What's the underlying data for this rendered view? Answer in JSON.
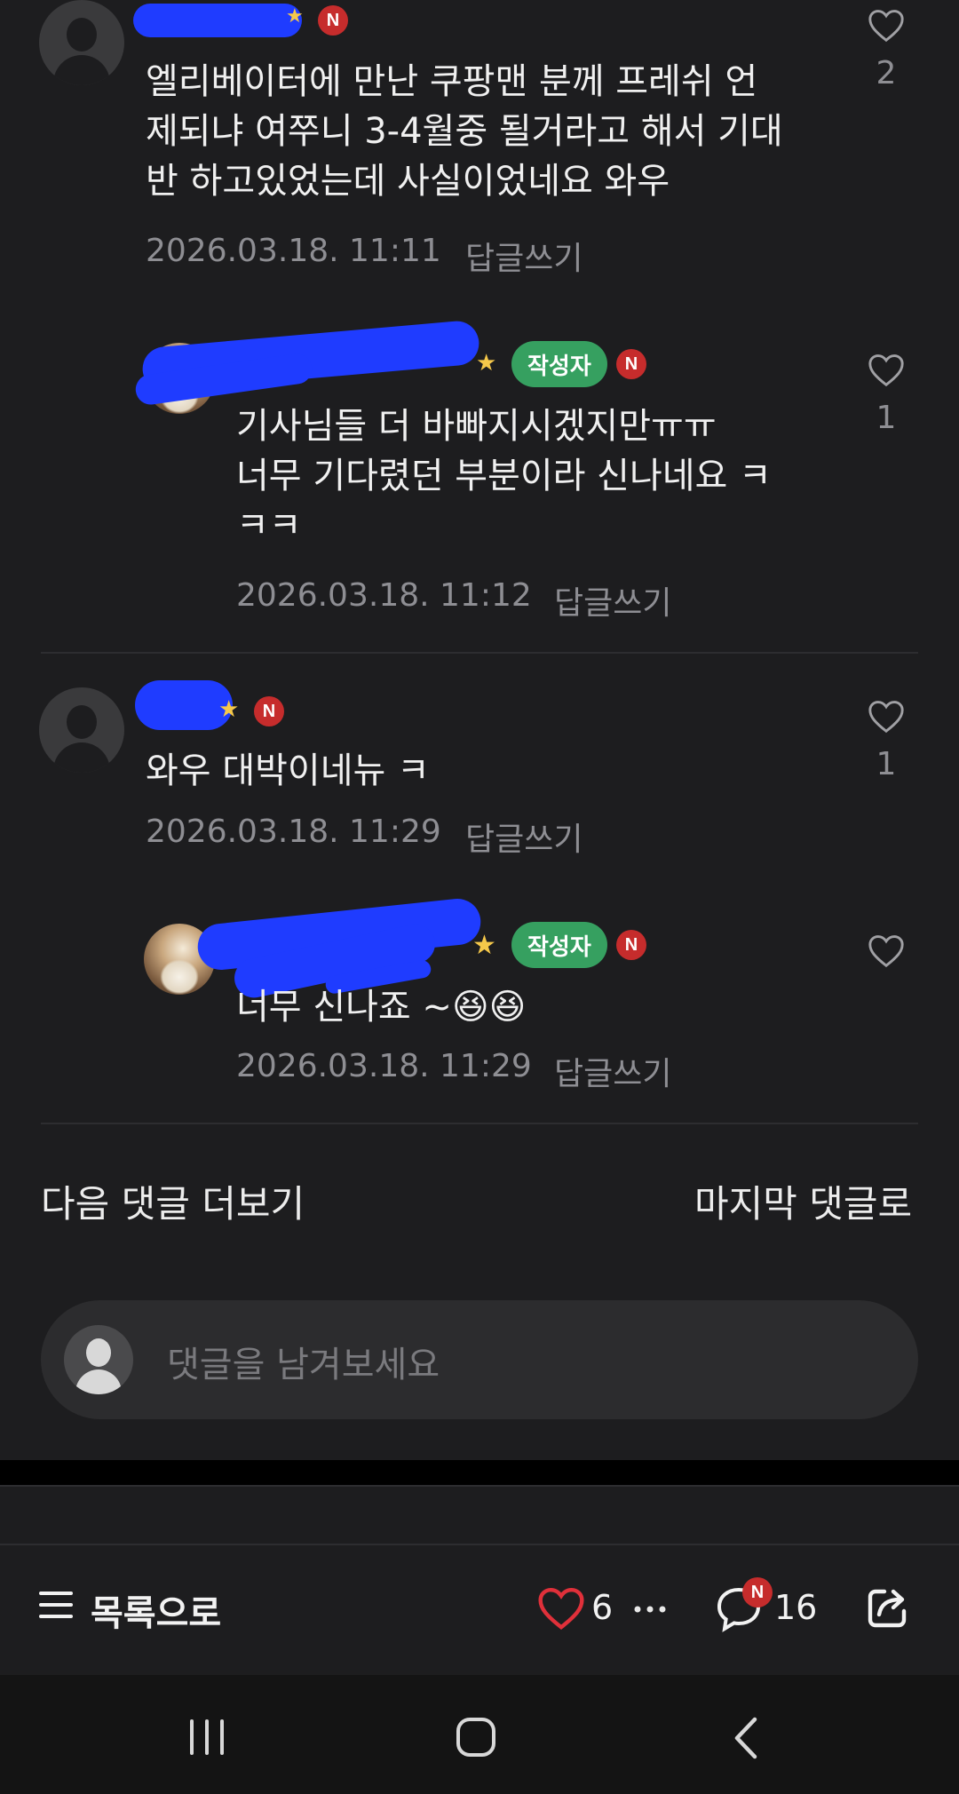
{
  "comments": [
    {
      "text_lines": [
        "엘리베이터에 만난 쿠팡맨 분께 프레쉬 언",
        "제되냐 여쭈니 3-4월중 될거라고 해서 기대",
        "반 하고있었는데 사실이었네요 와우"
      ],
      "date": "2026.03.18. 11:11",
      "reply_label": "답글쓰기",
      "likes": "2",
      "badge": "N"
    },
    {
      "text_lines": [
        "기사님들 더 바빠지시겠지만ㅠㅠ",
        "너무 기다렸던 부분이라 신나네요 ㅋ",
        "ㅋㅋ"
      ],
      "date": "2026.03.18. 11:12",
      "reply_label": "답글쓰기",
      "likes": "1",
      "author_tag": "작성자",
      "badge": "N"
    },
    {
      "text_lines": [
        "와우 대박이네뉴 ㅋ"
      ],
      "date": "2026.03.18. 11:29",
      "reply_label": "답글쓰기",
      "likes": "1",
      "badge": "N"
    },
    {
      "text_lines": [
        "너무 신나죠 ~😆😆"
      ],
      "date": "2026.03.18. 11:29",
      "reply_label": "답글쓰기",
      "author_tag": "작성자",
      "badge": "N"
    }
  ],
  "more_comments_label": "다음 댓글 더보기",
  "last_comment_label": "마지막 댓글로",
  "comment_input": {
    "placeholder": "댓글을 남겨보세요"
  },
  "bottom_bar": {
    "list_label": "목록으로",
    "like_count": "6",
    "comment_count": "16",
    "comment_badge": "N",
    "accent_color": "#e0303a"
  },
  "icons": [
    "heart-outline-icon",
    "star-icon",
    "menu-icon",
    "heart-icon",
    "more-icon",
    "comment-icon",
    "share-icon",
    "recent-apps-icon",
    "home-icon",
    "back-icon"
  ]
}
